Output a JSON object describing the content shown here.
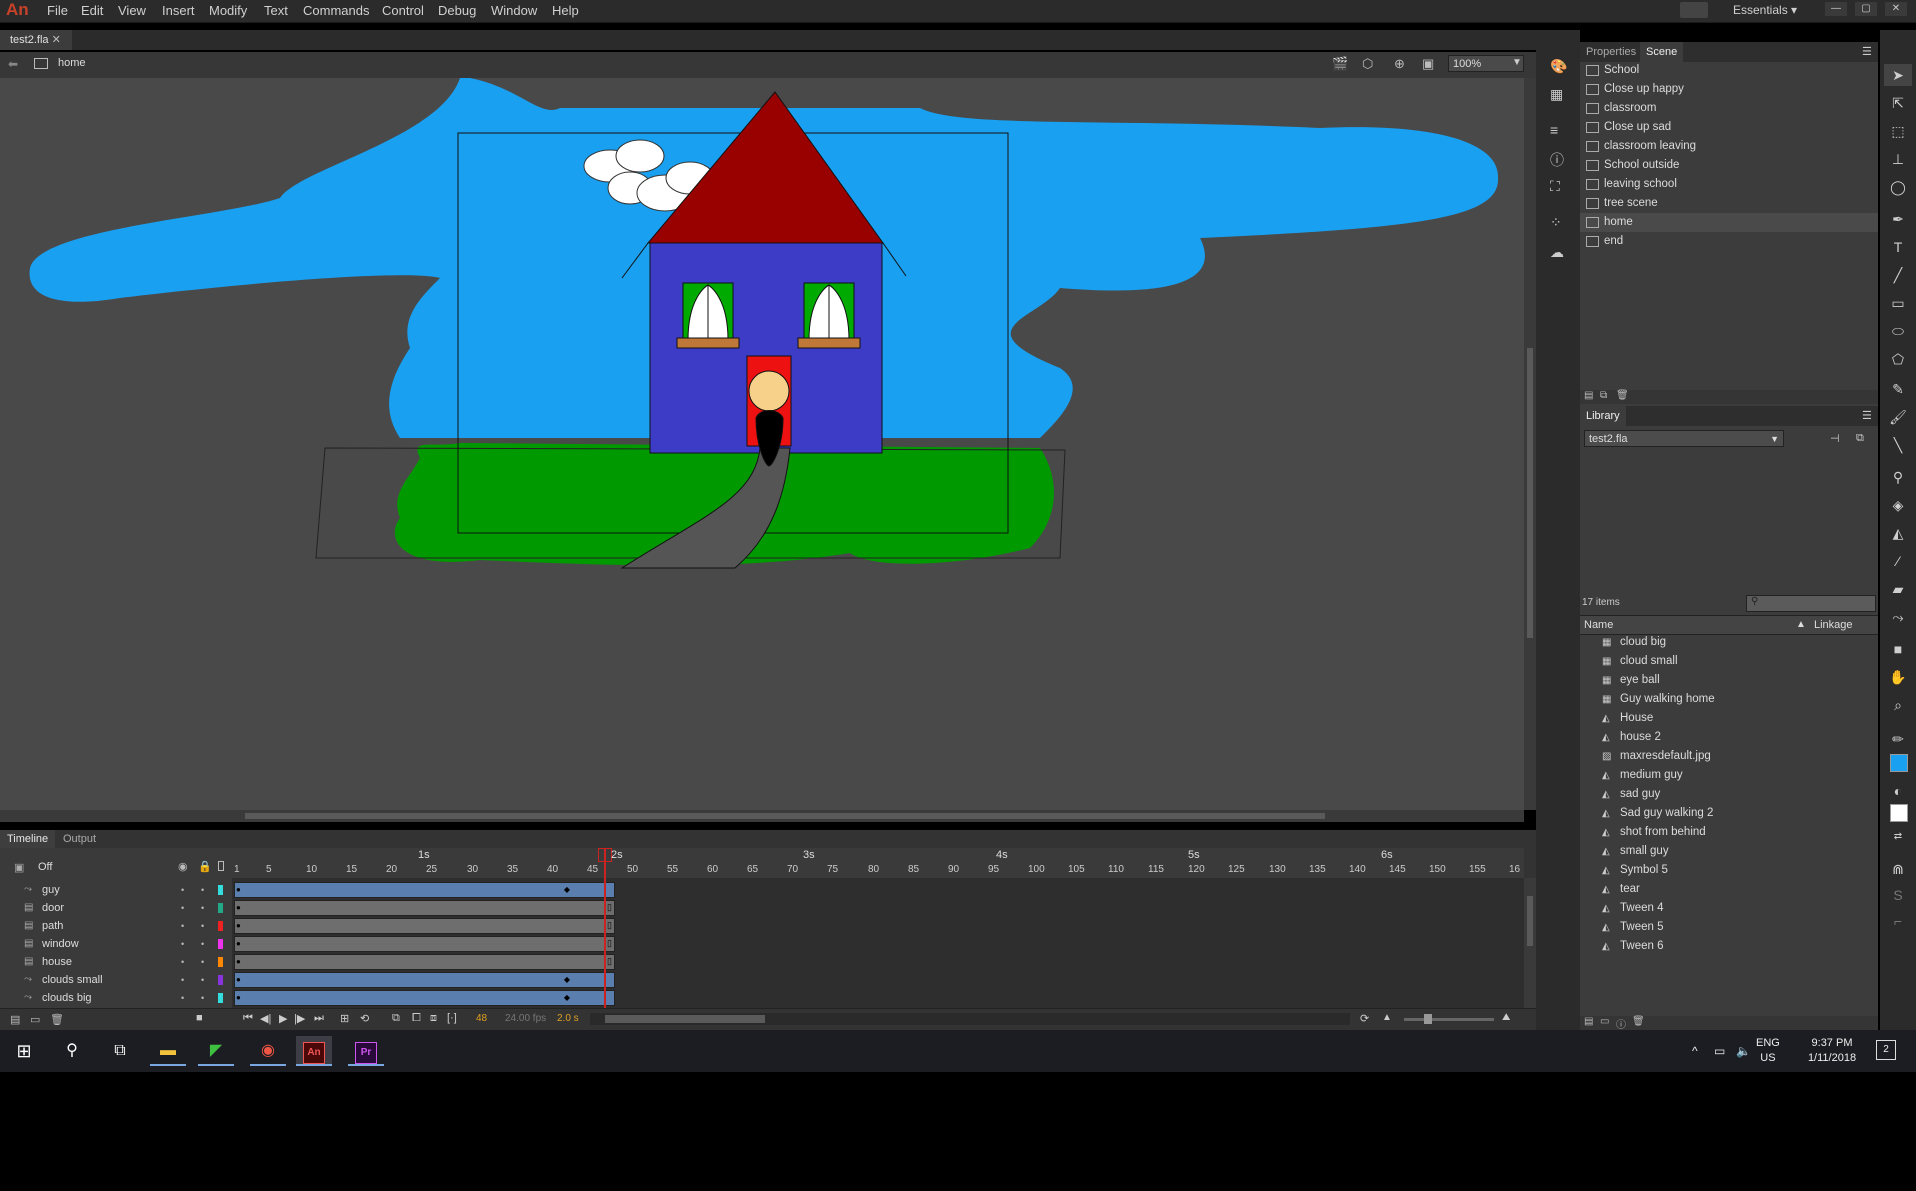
{
  "menubar": {
    "logo": "An",
    "items": [
      "File",
      "Edit",
      "View",
      "Insert",
      "Modify",
      "Text",
      "Commands",
      "Control",
      "Debug",
      "Window",
      "Help"
    ],
    "workspace": "Essentials"
  },
  "document": {
    "tab_title": "test2.fla",
    "breadcrumb_scene": "home",
    "zoom": "100%"
  },
  "timeline": {
    "tabs": [
      "Timeline",
      "Output"
    ],
    "layers_header": "Off",
    "layers": [
      {
        "name": "guy",
        "color": "#33dddd",
        "type": "motion"
      },
      {
        "name": "door",
        "color": "#22aa88",
        "type": "normal"
      },
      {
        "name": "path",
        "color": "#ee2222",
        "type": "normal"
      },
      {
        "name": "window",
        "color": "#ee33ee",
        "type": "normal"
      },
      {
        "name": "house",
        "color": "#ff8800",
        "type": "normal"
      },
      {
        "name": "clouds small",
        "color": "#8833dd",
        "type": "motion"
      },
      {
        "name": "clouds big",
        "color": "#33dddd",
        "type": "motion"
      }
    ],
    "seconds": [
      "1s",
      "2s",
      "3s",
      "4s",
      "5s",
      "6s"
    ],
    "frame_ticks": [
      "1",
      "5",
      "10",
      "15",
      "20",
      "25",
      "30",
      "35",
      "40",
      "45",
      "50",
      "55",
      "60",
      "65",
      "70",
      "75",
      "80",
      "85",
      "90",
      "95",
      "100",
      "105",
      "110",
      "115",
      "120",
      "125",
      "130",
      "135",
      "140",
      "145",
      "150",
      "155",
      "16"
    ],
    "current_frame": "48",
    "fps": "24.00 fps",
    "elapsed": "2.0 s"
  },
  "panels": {
    "tabs": [
      "Properties",
      "Scene"
    ],
    "scenes": [
      "School",
      "Close up happy",
      "classroom",
      "Close up sad",
      "classroom leaving",
      "School outside",
      "leaving school",
      "tree scene",
      "home",
      "end"
    ],
    "selected_scene": "home"
  },
  "library": {
    "title": "Library",
    "document": "test2.fla",
    "count": "17 items",
    "col_name": "Name",
    "col_linkage": "Linkage",
    "items": [
      {
        "name": "cloud big",
        "type": "symbol"
      },
      {
        "name": "cloud small",
        "type": "symbol"
      },
      {
        "name": "eye ball",
        "type": "symbol"
      },
      {
        "name": "Guy walking home",
        "type": "symbol"
      },
      {
        "name": "House",
        "type": "graphic"
      },
      {
        "name": "house 2",
        "type": "graphic"
      },
      {
        "name": "maxresdefault.jpg",
        "type": "bitmap"
      },
      {
        "name": "medium guy",
        "type": "graphic"
      },
      {
        "name": "sad guy",
        "type": "graphic"
      },
      {
        "name": "Sad guy walking 2",
        "type": "graphic"
      },
      {
        "name": "shot from behind",
        "type": "graphic"
      },
      {
        "name": "small guy",
        "type": "graphic"
      },
      {
        "name": "Symbol 5",
        "type": "graphic"
      },
      {
        "name": "tear",
        "type": "graphic"
      },
      {
        "name": "Tween 4",
        "type": "graphic"
      },
      {
        "name": "Tween 5",
        "type": "graphic"
      },
      {
        "name": "Tween 6",
        "type": "graphic"
      }
    ]
  },
  "taskbar": {
    "lang_top": "ENG",
    "lang_bottom": "US",
    "time": "9:37 PM",
    "date": "1/11/2018",
    "notifications": "2"
  },
  "colors": {
    "sky": "#1aa0f0",
    "grass": "#009a00",
    "roof": "#990000",
    "house_wall": "#3c3cc6",
    "door": "#ee1111",
    "path": "#555555",
    "accent_playhead": "#cc2222"
  }
}
